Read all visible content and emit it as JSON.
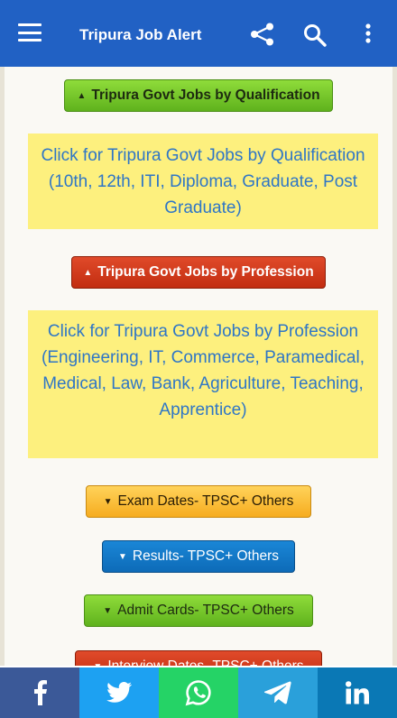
{
  "appbar": {
    "title": "Tripura Job Alert",
    "icons": [
      "menu-icon",
      "share-icon",
      "search-icon",
      "more-vert-icon"
    ],
    "color": "#2161c4"
  },
  "sections": {
    "qualification_button": "Tripura Govt Jobs by Qualification",
    "qualification_panel": "Click for Tripura Govt Jobs by Qualification (10th, 12th, ITI, Diploma, Graduate, Post Graduate)",
    "profession_button": "Tripura Govt Jobs by Profession",
    "profession_panel": "Click for Tripura Govt Jobs by Profession (Engineering, IT, Commerce, Paramedical, Medical, Law, Bank, Agriculture, Teaching, Apprentice)",
    "exam_dates_button": "Exam Dates- TPSC+ Others",
    "results_button": "Results- TPSC+ Others",
    "admit_cards_button": "Admit Cards- TPSC+ Others",
    "interview_dates_button": "Interview Dates- TPSC+ Others"
  },
  "share_bar": {
    "items": [
      "facebook-icon",
      "twitter-icon",
      "whatsapp-icon",
      "telegram-icon",
      "linkedin-icon"
    ],
    "colors": [
      "#3b5998",
      "#1da1f2",
      "#25d366",
      "#2aa0da",
      "#0a78b5"
    ]
  }
}
